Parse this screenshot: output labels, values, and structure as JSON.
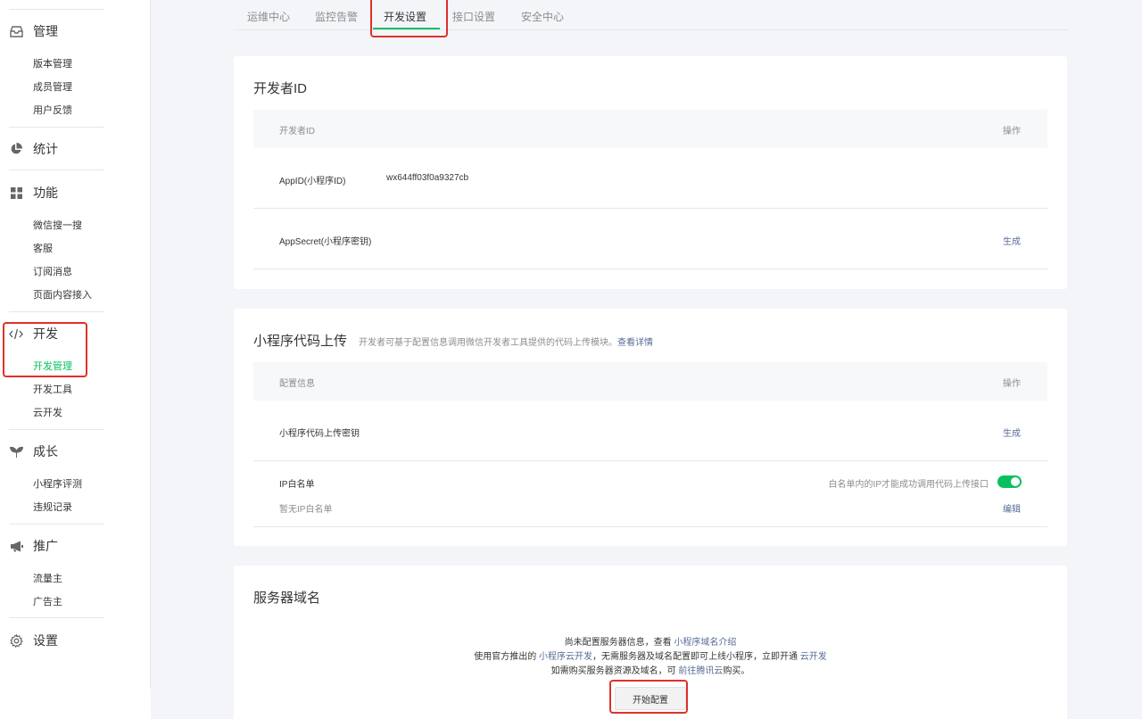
{
  "sidebar": {
    "sections": [
      {
        "label": "管理",
        "icon": "inbox-icon",
        "items": [
          "版本管理",
          "成员管理",
          "用户反馈"
        ]
      },
      {
        "label": "统计",
        "icon": "pie-chart-icon",
        "items": []
      },
      {
        "label": "功能",
        "icon": "grid-icon",
        "items": [
          "微信搜一搜",
          "客服",
          "订阅消息",
          "页面内容接入"
        ]
      },
      {
        "label": "开发",
        "icon": "code-icon",
        "items": [
          "开发管理",
          "开发工具",
          "云开发"
        ],
        "active_item": "开发管理"
      },
      {
        "label": "成长",
        "icon": "sprout-icon",
        "items": [
          "小程序评测",
          "违规记录"
        ]
      },
      {
        "label": "推广",
        "icon": "megaphone-icon",
        "items": [
          "流量主",
          "广告主"
        ]
      },
      {
        "label": "设置",
        "icon": "gear-icon",
        "items": []
      }
    ]
  },
  "tabs": [
    "运维中心",
    "监控告警",
    "开发设置",
    "接口设置",
    "安全中心"
  ],
  "active_tab": "开发设置",
  "dev_id_card": {
    "title": "开发者ID",
    "col_name": "开发者ID",
    "col_action": "操作",
    "appid_label": "AppID(小程序ID)",
    "appid_value": "wx644ff03f0a9327cb",
    "secret_label": "AppSecret(小程序密钥)",
    "secret_action": "生成"
  },
  "upload_card": {
    "title": "小程序代码上传",
    "desc": "开发者可基于配置信息调用微信开发者工具提供的代码上传模块。",
    "desc_link": "查看详情",
    "col_name": "配置信息",
    "col_action": "操作",
    "key_label": "小程序代码上传密钥",
    "key_action": "生成",
    "ip_label": "IP白名单",
    "ip_hint": "白名单内的IP才能成功调用代码上传接口",
    "ip_toggle_on": true,
    "ip_empty": "暂无IP白名单",
    "ip_action": "编辑"
  },
  "server_card": {
    "title": "服务器域名",
    "line1_text": "尚未配置服务器信息，查看",
    "line1_link": "小程序域名介绍",
    "line2_text_a": "使用官方推出的",
    "line2_link_a": "小程序云开发",
    "line2_text_b": "，无需服务器及域名配置即可上线小程序，立即开通",
    "line2_link_b": "云开发",
    "line3_text_a": "如需购买服务器资源及域名，可",
    "line3_link": "前往腾讯云",
    "line3_text_b": "购买。",
    "button": "开始配置"
  },
  "colors": {
    "accent": "#07c160",
    "link": "#576b95",
    "highlight": "#e0302a"
  }
}
